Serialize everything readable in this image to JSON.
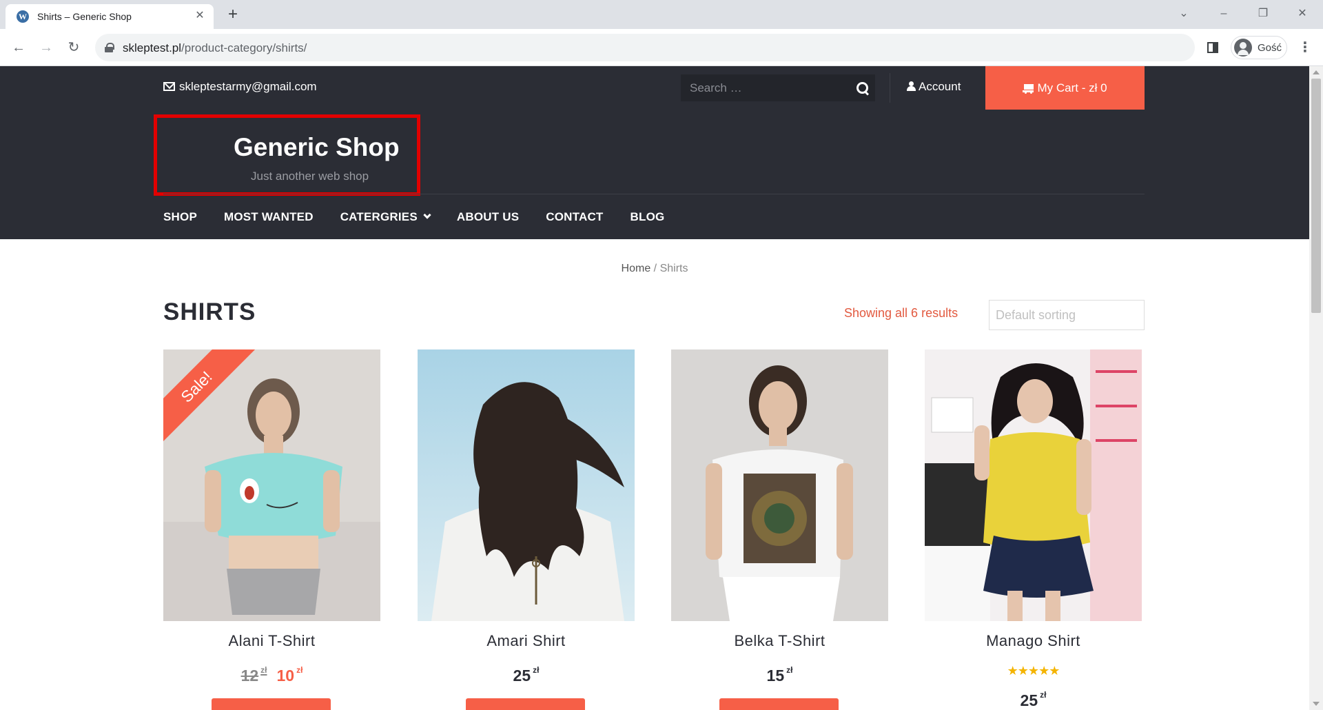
{
  "browser": {
    "tab_title": "Shirts – Generic Shop",
    "url_domain": "skleptest.pl",
    "url_path": "/product-category/shirts/",
    "profile_label": "Gość"
  },
  "topbar": {
    "email": "skleptestarmy@gmail.com",
    "search_placeholder": "Search …",
    "account_label": "Account",
    "cart_label": "My Cart - zł 0"
  },
  "site": {
    "title": "Generic Shop",
    "tagline": "Just another web shop"
  },
  "nav": {
    "items": [
      "SHOP",
      "MOST WANTED",
      "CATERGRIES",
      "ABOUT US",
      "CONTACT",
      "BLOG"
    ]
  },
  "breadcrumb": {
    "home": "Home",
    "separator": " / ",
    "current": "Shirts"
  },
  "listing": {
    "title": "SHIRTS",
    "result_count": "Showing all 6 results",
    "sort_value": "Default sorting"
  },
  "products": [
    {
      "name": "Alani T-Shirt",
      "old_price": "12",
      "price": "10",
      "currency": "zł",
      "badge": "Sale!"
    },
    {
      "name": "Amari Shirt",
      "price": "25",
      "currency": "zł"
    },
    {
      "name": "Belka T-Shirt",
      "price": "15",
      "currency": "zł"
    },
    {
      "name": "Manago Shirt",
      "price": "25",
      "currency": "zł",
      "rating": 5
    }
  ],
  "colors": {
    "accent": "#f65f47",
    "dark": "#2b2d35",
    "highlight_border": "#e20000"
  }
}
